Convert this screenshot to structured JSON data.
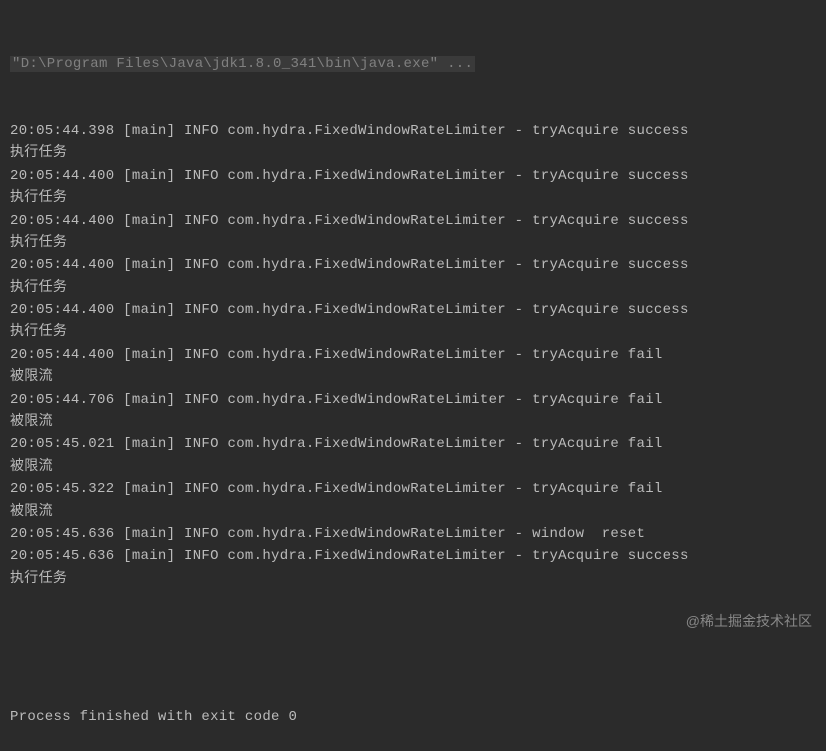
{
  "console": {
    "command": "\"D:\\Program Files\\Java\\jdk1.8.0_341\\bin\\java.exe\" ...",
    "lines": [
      {
        "type": "log",
        "text": "20:05:44.398 [main] INFO com.hydra.FixedWindowRateLimiter - tryAcquire success"
      },
      {
        "type": "task",
        "text": "执行任务"
      },
      {
        "type": "log",
        "text": "20:05:44.400 [main] INFO com.hydra.FixedWindowRateLimiter - tryAcquire success"
      },
      {
        "type": "task",
        "text": "执行任务"
      },
      {
        "type": "log",
        "text": "20:05:44.400 [main] INFO com.hydra.FixedWindowRateLimiter - tryAcquire success"
      },
      {
        "type": "task",
        "text": "执行任务"
      },
      {
        "type": "log",
        "text": "20:05:44.400 [main] INFO com.hydra.FixedWindowRateLimiter - tryAcquire success"
      },
      {
        "type": "task",
        "text": "执行任务"
      },
      {
        "type": "log",
        "text": "20:05:44.400 [main] INFO com.hydra.FixedWindowRateLimiter - tryAcquire success"
      },
      {
        "type": "task",
        "text": "执行任务"
      },
      {
        "type": "log",
        "text": "20:05:44.400 [main] INFO com.hydra.FixedWindowRateLimiter - tryAcquire fail"
      },
      {
        "type": "task",
        "text": "被限流"
      },
      {
        "type": "log",
        "text": "20:05:44.706 [main] INFO com.hydra.FixedWindowRateLimiter - tryAcquire fail"
      },
      {
        "type": "task",
        "text": "被限流"
      },
      {
        "type": "log",
        "text": "20:05:45.021 [main] INFO com.hydra.FixedWindowRateLimiter - tryAcquire fail"
      },
      {
        "type": "task",
        "text": "被限流"
      },
      {
        "type": "log",
        "text": "20:05:45.322 [main] INFO com.hydra.FixedWindowRateLimiter - tryAcquire fail"
      },
      {
        "type": "task",
        "text": "被限流"
      },
      {
        "type": "log",
        "text": "20:05:45.636 [main] INFO com.hydra.FixedWindowRateLimiter - window  reset"
      },
      {
        "type": "log",
        "text": "20:05:45.636 [main] INFO com.hydra.FixedWindowRateLimiter - tryAcquire success"
      },
      {
        "type": "task",
        "text": "执行任务"
      }
    ],
    "exit": "Process finished with exit code 0"
  },
  "watermark": "@稀土掘金技术社区"
}
